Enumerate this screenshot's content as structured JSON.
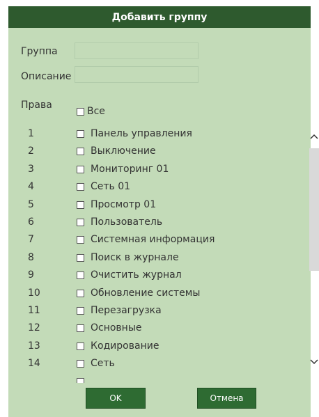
{
  "dialog": {
    "title": "Добавить группу"
  },
  "form": {
    "group_label": "Группа",
    "group_value": "",
    "description_label": "Описание",
    "description_value": "",
    "rights_label": "Права",
    "all_label": "Все"
  },
  "permissions": [
    {
      "num": "1",
      "label": "Панель управления"
    },
    {
      "num": "2",
      "label": "Выключение"
    },
    {
      "num": "3",
      "label": "Мониторинг 01"
    },
    {
      "num": "4",
      "label": "Сеть 01"
    },
    {
      "num": "5",
      "label": "Просмотр 01"
    },
    {
      "num": "6",
      "label": "Пользователь"
    },
    {
      "num": "7",
      "label": "Системная информация"
    },
    {
      "num": "8",
      "label": "Поиск в журнале"
    },
    {
      "num": "9",
      "label": "Очистить журнал"
    },
    {
      "num": "10",
      "label": "Обновление системы"
    },
    {
      "num": "11",
      "label": "Перезагрузка"
    },
    {
      "num": "12",
      "label": "Основные"
    },
    {
      "num": "13",
      "label": "Кодирование"
    },
    {
      "num": "14",
      "label": "Сеть"
    }
  ],
  "buttons": {
    "ok": "OK",
    "cancel": "Отмена"
  },
  "icons": {
    "scroll_up": "chevron-up-icon",
    "scroll_down": "chevron-down-icon"
  }
}
